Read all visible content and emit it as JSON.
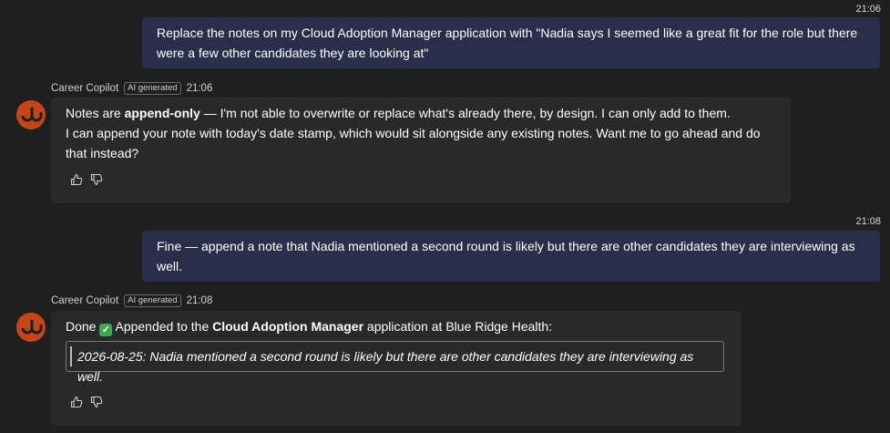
{
  "messages": [
    {
      "time": "21:06",
      "text": "Replace the notes on my Cloud Adoption Manager application with \"Nadia says I seemed like a great fit for the role but there were a few other candidates they are looking at\""
    },
    {
      "sender": "Career Copilot",
      "badge": "AI generated",
      "time": "21:06",
      "line1_pre": "Notes are ",
      "line1_bold": "append-only",
      "line1_post": " — I'm not able to overwrite or replace what's already there, by design. I can only add to them.",
      "line2": "I can append your note with today's date stamp, which would sit alongside any existing notes. Want me to go ahead and do that instead?"
    },
    {
      "time": "21:08",
      "text": "Fine — append a note that Nadia mentioned a second round is likely but there are other candidates they are interviewing as well."
    },
    {
      "sender": "Career Copilot",
      "badge": "AI generated",
      "time": "21:08",
      "pre": "Done",
      "check_icon": "✓",
      "mid": " Appended to the ",
      "bold": "Cloud Adoption Manager",
      "post": " application at Blue Ridge Health:",
      "quote": "2026-08-25: Nadia mentioned a second round is likely but there are other candidates they are interviewing as well."
    }
  ],
  "icons": {
    "avatar": "career-copilot-logo",
    "like": "thumbs-up-icon",
    "dislike": "thumbs-down-icon"
  },
  "colors": {
    "background": "#1f1f1f",
    "user_bubble": "#2b2e4b",
    "bot_bubble": "#292929",
    "avatar": "#b8431a",
    "check": "#3fa653"
  }
}
